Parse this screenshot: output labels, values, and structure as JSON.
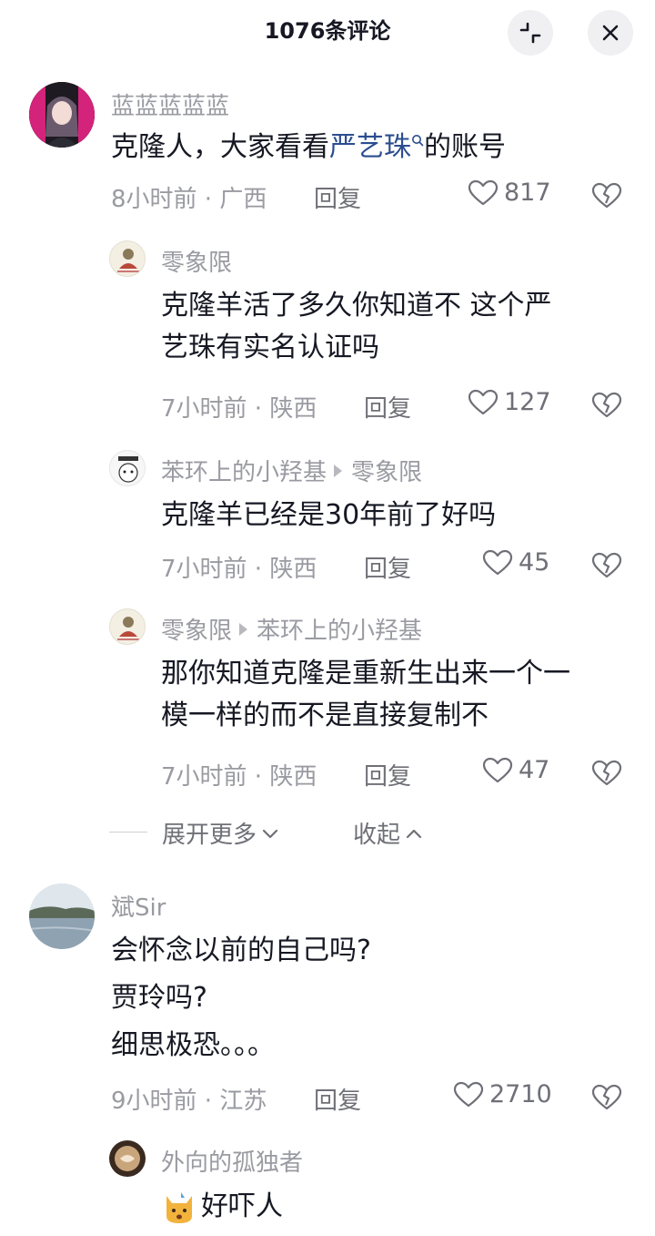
{
  "header": {
    "title": "1076条评论"
  },
  "comments": [
    {
      "username": "蓝蓝蓝蓝蓝",
      "text_before": "克隆人，大家看看",
      "link": "严艺珠",
      "text_after": "的账号",
      "time_location": "8小时前 · 广西",
      "reply_label": "回复",
      "likes": "817"
    },
    {
      "username": "零象限",
      "text_lines": [
        "克隆羊活了多久你知道不 这个严",
        "艺珠有实名认证吗"
      ],
      "time_location": "7小时前 · 陕西",
      "reply_label": "回复",
      "likes": "127"
    },
    {
      "username": "苯环上的小羟基",
      "reply_to": "零象限",
      "text_lines": [
        "克隆羊已经是30年前了好吗"
      ],
      "time_location": "7小时前 · 陕西",
      "reply_label": "回复",
      "likes": "45"
    },
    {
      "username": "零象限",
      "reply_to": "苯环上的小羟基",
      "text_lines": [
        "那你知道克隆是重新生出来一个一",
        "模一样的而不是直接复制不"
      ],
      "time_location": "7小时前 · 陕西",
      "reply_label": "回复",
      "likes": "47"
    },
    {
      "username": "斌Sir",
      "text_lines": [
        "会怀念以前的自己吗?",
        "贾玲吗?",
        "细思极恐。。。"
      ],
      "time_location": "9小时前 · 江苏",
      "reply_label": "回复",
      "likes": "2710"
    },
    {
      "username": "外向的孤独者",
      "text_lines": [
        "好吓人"
      ],
      "sticker": "cat-emoji"
    }
  ],
  "thread_controls": {
    "expand_more": "展开更多",
    "collapse": "收起"
  },
  "colors": {
    "link": "#2b4d8f",
    "muted": "#9a9ba2"
  }
}
